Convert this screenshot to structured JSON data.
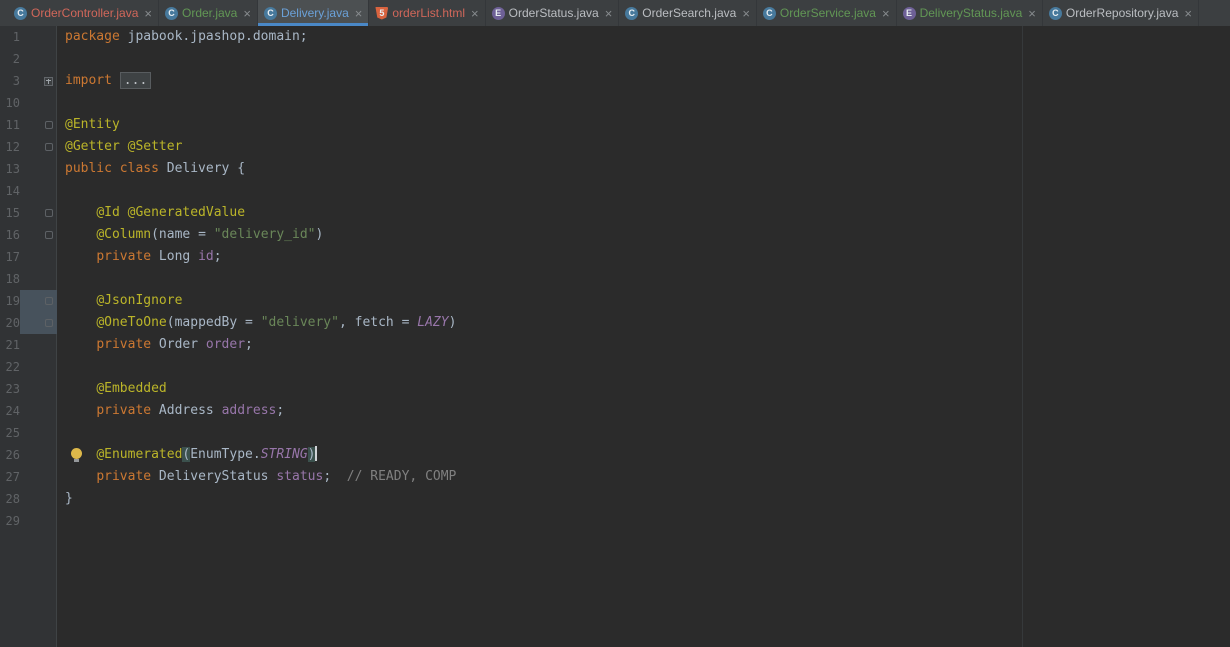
{
  "colors": {
    "editor_bg": "#2b2b2b",
    "gutter_bg": "#313335",
    "tabbar_bg": "#3c3f41",
    "active_tab_bg": "#4c5052",
    "active_tab_underline": "#4a88c7",
    "line_number": "#606366",
    "keyword": "#cc7832",
    "annotation": "#bbb529",
    "string": "#6a8759",
    "field": "#9876aa",
    "comment": "#808080",
    "plain_text": "#a9b7c6",
    "vcs_unversioned": "#d1675a",
    "vcs_added": "#629755",
    "active_file": "#6ba1d8"
  },
  "icons": {
    "class": "C",
    "enum": "E",
    "html": "5"
  },
  "tab_close_glyph": "×",
  "tabs": [
    {
      "label": "OrderController.java",
      "icon": "class",
      "color": "#d1675a",
      "active": false
    },
    {
      "label": "Order.java",
      "icon": "class",
      "color": "#629755",
      "active": false
    },
    {
      "label": "Delivery.java",
      "icon": "class",
      "color": "#6ba1d8",
      "active": true
    },
    {
      "label": "orderList.html",
      "icon": "html",
      "color": "#d1675a",
      "active": false
    },
    {
      "label": "OrderStatus.java",
      "icon": "enum",
      "color": "#bbbec2",
      "active": false
    },
    {
      "label": "OrderSearch.java",
      "icon": "class",
      "color": "#bbbec2",
      "active": false
    },
    {
      "label": "OrderService.java",
      "icon": "class",
      "color": "#629755",
      "active": false
    },
    {
      "label": "DeliveryStatus.java",
      "icon": "enum",
      "color": "#629755",
      "active": false
    },
    {
      "label": "OrderRepository.java",
      "icon": "class",
      "color": "#bbbec2",
      "active": false
    }
  ],
  "editor": {
    "file": "Delivery.java",
    "caret_line": 26,
    "lines": [
      {
        "num": 1,
        "seg": [
          [
            "kw",
            "package"
          ],
          [
            "pln",
            " jpabook.jpashop.domain;"
          ]
        ]
      },
      {
        "num": 2,
        "seg": []
      },
      {
        "num": 3,
        "seg": [
          [
            "kw",
            "import"
          ],
          [
            "pln",
            " "
          ],
          [
            "fold",
            "..."
          ]
        ],
        "gutter": "fold"
      },
      {
        "num": 10,
        "seg": []
      },
      {
        "num": 11,
        "seg": [
          [
            "ann",
            "@Entity"
          ]
        ],
        "gutter": "mark"
      },
      {
        "num": 12,
        "seg": [
          [
            "ann",
            "@Getter @Setter"
          ]
        ],
        "gutter": "mark"
      },
      {
        "num": 13,
        "seg": [
          [
            "kw",
            "public class"
          ],
          [
            "pln",
            " Delivery {"
          ]
        ]
      },
      {
        "num": 14,
        "seg": []
      },
      {
        "num": 15,
        "seg": [
          [
            "pln",
            "    "
          ],
          [
            "ann",
            "@Id @GeneratedValue"
          ]
        ],
        "gutter": "mark"
      },
      {
        "num": 16,
        "seg": [
          [
            "pln",
            "    "
          ],
          [
            "ann",
            "@Column"
          ],
          [
            "pln",
            "(name = "
          ],
          [
            "str",
            "\"delivery_id\""
          ],
          [
            "pln",
            ")"
          ]
        ],
        "gutter": "mark"
      },
      {
        "num": 17,
        "seg": [
          [
            "pln",
            "    "
          ],
          [
            "kw",
            "private"
          ],
          [
            "pln",
            " Long "
          ],
          [
            "fld",
            "id"
          ],
          [
            "pln",
            ";"
          ]
        ]
      },
      {
        "num": 18,
        "seg": []
      },
      {
        "num": 19,
        "seg": [
          [
            "pln",
            "    "
          ],
          [
            "ann",
            "@JsonIgnore"
          ]
        ],
        "gutter": "mark",
        "gutterHl": true
      },
      {
        "num": 20,
        "seg": [
          [
            "pln",
            "    "
          ],
          [
            "ann",
            "@OneToOne"
          ],
          [
            "pln",
            "(mappedBy = "
          ],
          [
            "str",
            "\"delivery\""
          ],
          [
            "pln",
            ", fetch = "
          ],
          [
            "con",
            "LAZY"
          ],
          [
            "pln",
            ")"
          ]
        ],
        "gutter": "mark",
        "gutterHl": true
      },
      {
        "num": 21,
        "seg": [
          [
            "pln",
            "    "
          ],
          [
            "kw",
            "private"
          ],
          [
            "pln",
            " Order "
          ],
          [
            "fld",
            "order"
          ],
          [
            "pln",
            ";"
          ]
        ]
      },
      {
        "num": 22,
        "seg": []
      },
      {
        "num": 23,
        "seg": [
          [
            "pln",
            "    "
          ],
          [
            "ann",
            "@Embedded"
          ]
        ]
      },
      {
        "num": 24,
        "seg": [
          [
            "pln",
            "    "
          ],
          [
            "kw",
            "private"
          ],
          [
            "pln",
            " Address "
          ],
          [
            "fld",
            "address"
          ],
          [
            "pln",
            ";"
          ]
        ]
      },
      {
        "num": 25,
        "seg": []
      },
      {
        "num": 26,
        "seg": [
          [
            "pln",
            "    "
          ],
          [
            "ann",
            "@Enumerated"
          ],
          [
            "par",
            "("
          ],
          [
            "pln",
            "EnumType."
          ],
          [
            "con",
            "STRING"
          ],
          [
            "par",
            ")"
          ]
        ],
        "bulb": true,
        "caret": true
      },
      {
        "num": 27,
        "seg": [
          [
            "pln",
            "    "
          ],
          [
            "kw",
            "private"
          ],
          [
            "pln",
            " DeliveryStatus "
          ],
          [
            "fld",
            "status"
          ],
          [
            "pln",
            ";  "
          ],
          [
            "cmt",
            "// READY, COMP"
          ]
        ]
      },
      {
        "num": 28,
        "seg": [
          [
            "pln",
            "}"
          ]
        ]
      },
      {
        "num": 29,
        "seg": []
      }
    ]
  }
}
